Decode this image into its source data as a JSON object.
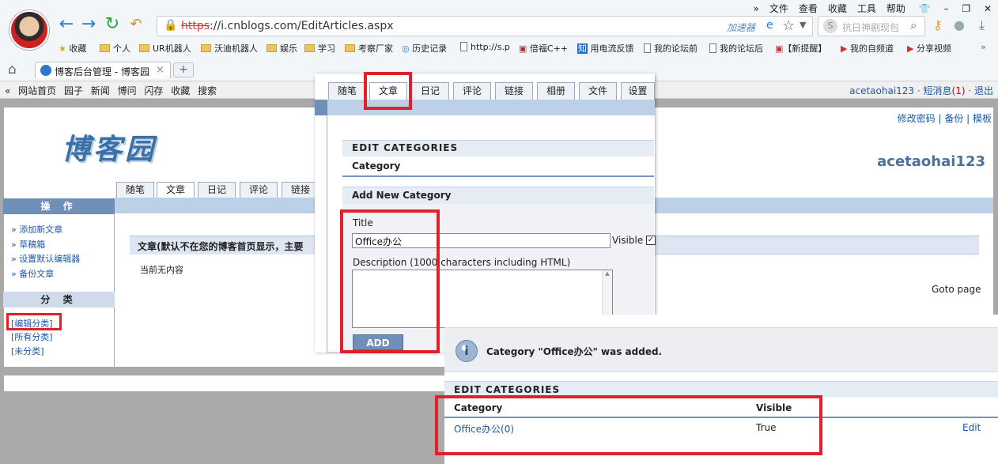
{
  "browser": {
    "menu": [
      "»",
      "文件",
      "查看",
      "收藏",
      "工具",
      "帮助"
    ],
    "url_scheme": "https",
    "url_rest": "://i.cnblogs.com/EditArticles.aspx",
    "accelerator": "加速器",
    "search_placeholder": "抗日神剧现包",
    "bookmarks": [
      "收藏",
      "个人",
      "UR机器人",
      "沃迪机器人",
      "娱乐",
      "学习",
      "考察厂家",
      "历史记录",
      "http://s.p",
      "倍福C++",
      "用电流反馈",
      "我的论坛前",
      "我的论坛后",
      "【新提醒】",
      "我的自频道",
      "分享视频"
    ],
    "tab_title": "博客后台管理 - 博客园"
  },
  "sitenav": {
    "left": "« 网站首页 园子 新闻 博问 闪存 收藏 搜索",
    "user": "acetaohai123",
    "msg_label": "短消息",
    "msg_count": "(1)",
    "logout": "退出"
  },
  "blog": {
    "logo": "博客园",
    "username": "acetaohai123",
    "toplinks": "修改密码 | 备份 | 模板",
    "tabs": [
      "随笔",
      "文章",
      "日记",
      "评论",
      "链接"
    ],
    "sidebar_ops_title": "操 作",
    "sidebar_ops": [
      "» 添加新文章",
      "» 草稿箱",
      "» 设置默认编辑器",
      "» 备份文章"
    ],
    "sidebar_cat_title": "分 类",
    "sidebar_cats": [
      "[编辑分类]",
      "[所有分类]",
      "[未分类]"
    ],
    "article_header": "文章(默认不在您的博客首页显示，主要",
    "no_content": "当前无内容",
    "goto": "Goto page"
  },
  "panel1": {
    "tabs": [
      "随笔",
      "文章",
      "日记",
      "评论",
      "链接",
      "相册",
      "文件",
      "设置"
    ],
    "edit_categories": "EDIT CATEGORIES",
    "category": "Category",
    "add_new_category": "Add New Category",
    "title_label": "Title",
    "title_value": "Office办公",
    "visible_label": "Visible",
    "desc_label": "Description (1000 characters including HTML)",
    "add_button": "ADD"
  },
  "panel2": {
    "message": "Category \"Office办公\" was added.",
    "edit_categories": "EDIT CATEGORIES",
    "col_category": "Category",
    "col_visible": "Visible",
    "row_category": "Office办公(0)",
    "row_visible": "True",
    "row_edit": "Edit"
  }
}
